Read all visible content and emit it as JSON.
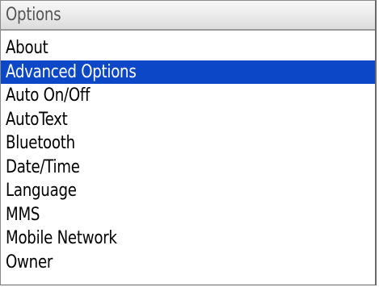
{
  "header": {
    "title": "Options"
  },
  "menu": {
    "items": [
      {
        "label": "About",
        "selected": false
      },
      {
        "label": "Advanced Options",
        "selected": true
      },
      {
        "label": "Auto On/Off",
        "selected": false
      },
      {
        "label": "AutoText",
        "selected": false
      },
      {
        "label": "Bluetooth",
        "selected": false
      },
      {
        "label": "Date/Time",
        "selected": false
      },
      {
        "label": "Language",
        "selected": false
      },
      {
        "label": "MMS",
        "selected": false
      },
      {
        "label": "Mobile Network",
        "selected": false
      },
      {
        "label": "Owner",
        "selected": false
      }
    ]
  },
  "colors": {
    "selection_background": "#0b47c6",
    "selection_text": "#ffffff",
    "title_text": "#555555"
  }
}
